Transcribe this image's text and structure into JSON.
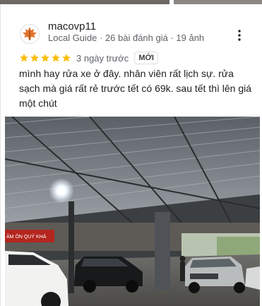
{
  "review": {
    "author_name": "macovp11",
    "author_meta": "Local Guide · 26 bài đánh giá · 19 ảnh",
    "rating": 5,
    "time": "3 ngày trước",
    "badge": "MỚI",
    "text": "mình hay rửa xe ở đây. nhân viên rất lịch sự. rửa sạch mà giá rất rẻ trước tết có 69k. sau tết thì lên giá một chút",
    "more_menu_icon": "more-vert-icon",
    "avatar_icon": "maple-leaf-icon"
  },
  "photo": {
    "subject": "car-wash-garage-photo",
    "sign_text": "ÂM ÔN QUÝ KHÁ"
  },
  "colors": {
    "star": "#fbbc04",
    "text_primary": "#202124",
    "text_secondary": "#5f6368",
    "border": "#dadce0"
  }
}
